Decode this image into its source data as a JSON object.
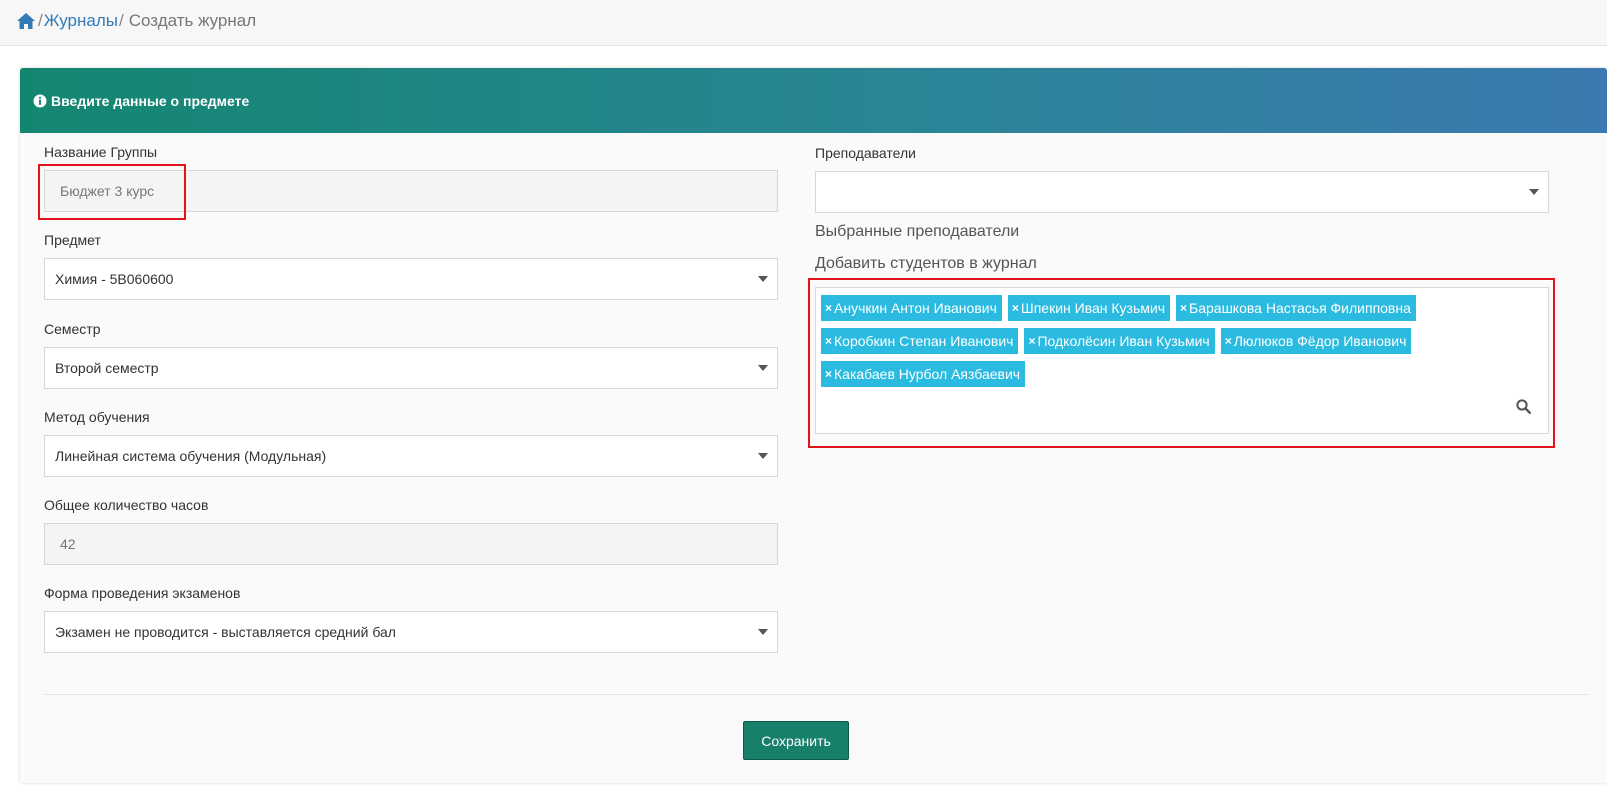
{
  "breadcrumb": {
    "home_icon": "home-icon",
    "separator": "/",
    "journals": "Журналы",
    "current": "Создать журнал"
  },
  "card": {
    "header_icon": "info-circle-icon",
    "header_title": "Введите данные о предмете",
    "header_gradient": [
      "#138670",
      "#3a7ab0"
    ]
  },
  "form": {
    "group_name": {
      "label": "Название Группы",
      "placeholder": "Бюджет 3 курс"
    },
    "subject": {
      "label": "Предмет",
      "value": "Химия - 5B060600"
    },
    "semester": {
      "label": "Семестр",
      "value": "Второй семестр"
    },
    "method": {
      "label": "Метод обучения",
      "value": "Линейная система обучения (Модульная)"
    },
    "hours": {
      "label": "Общее количество часов",
      "value": "42"
    },
    "exam_form": {
      "label": "Форма проведения экзаменов",
      "value": "Экзамен не проводится - выставляется средний бал"
    },
    "teachers": {
      "label": "Преподаватели",
      "value": ""
    },
    "selected_teachers_label": "Выбранные преподаватели",
    "add_students_label": "Добавить студентов в журнал",
    "students": [
      "Анучкин Антон Иванович",
      "Шпекин Иван Кузьмич",
      "Барашкова Настасья Филипповна",
      "Коробкин Степан Иванович",
      "Подколёсин Иван Кузьмич",
      "Люлюков Фёдор Иванович",
      "Какабаев Нурбол Аязбаевич"
    ],
    "tag_remove": "×",
    "search_icon": "search-icon"
  },
  "actions": {
    "save_label": "Сохранить"
  },
  "colors": {
    "tag": "#2bbbe0",
    "save_button": "#177f6a",
    "highlight": "#e0141b",
    "link": "#337ab7"
  }
}
